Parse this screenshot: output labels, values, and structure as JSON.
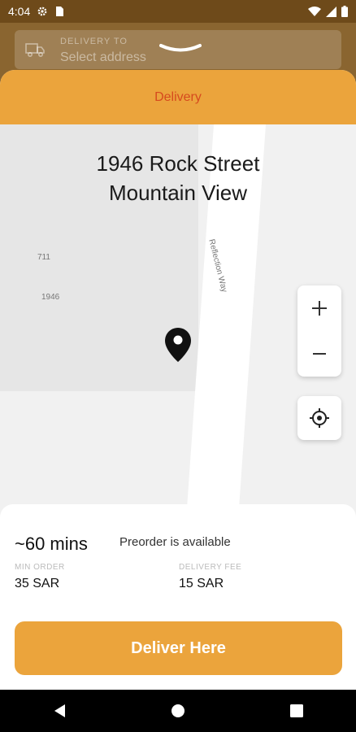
{
  "status_bar": {
    "time": "4:04"
  },
  "header": {
    "delivery_to_label": "DELIVERY TO",
    "address_placeholder": "Select address"
  },
  "tabs": {
    "active_label": "Delivery"
  },
  "map": {
    "address_line1": "1946 Rock Street",
    "address_line2": "Mountain View",
    "road_label": "Reflection Way",
    "building_numbers": [
      "711",
      "1946"
    ]
  },
  "info": {
    "eta": "~60 mins",
    "preorder": "Preorder is available",
    "min_order_label": "MIN ORDER",
    "min_order_value": "35 SAR",
    "delivery_fee_label": "DELIVERY FEE",
    "delivery_fee_value": "15 SAR"
  },
  "cta": {
    "label": "Deliver Here"
  },
  "colors": {
    "accent": "#eba43c",
    "tab_text": "#d64a1e"
  },
  "icons": [
    "gear-icon",
    "sim-icon",
    "wifi-icon",
    "signal-icon",
    "battery-icon",
    "truck-icon",
    "chevron-down-icon",
    "map-pin-icon",
    "zoom-in-icon",
    "zoom-out-icon",
    "locate-icon",
    "back-icon",
    "home-icon",
    "recents-icon"
  ]
}
